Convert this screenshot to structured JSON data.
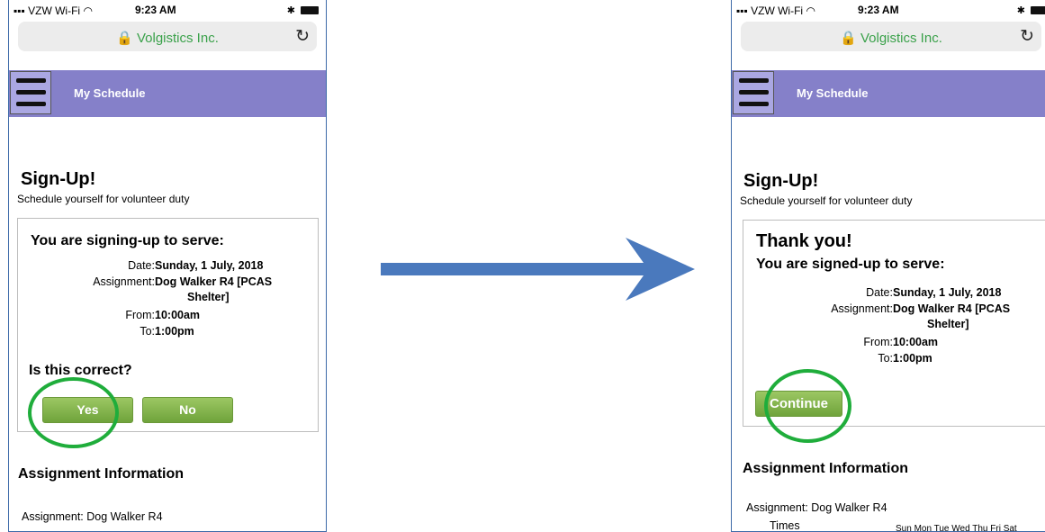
{
  "status_bar": {
    "carrier": "VZW Wi-Fi",
    "time": "9:23 AM"
  },
  "browser": {
    "site": "Volgistics Inc."
  },
  "nav": {
    "title": "My Schedule"
  },
  "page": {
    "title": "Sign-Up!",
    "subtitle": "Schedule yourself for volunteer duty"
  },
  "left": {
    "heading": "You are signing-up to serve:",
    "date_label": "Date:",
    "date_value": "Sunday, 1 July, 2018",
    "assignment_label": "Assignment:",
    "assignment_value_1": "Dog Walker R4 [PCAS",
    "assignment_value_2": "Shelter]",
    "from_label": "From:",
    "from_value": "10:00am",
    "to_label": "To:",
    "to_value": "1:00pm",
    "question": "Is this correct?",
    "yes_label": "Yes",
    "no_label": "No",
    "section_title": "Assignment Information",
    "assignment_info": "Assignment: Dog Walker R4"
  },
  "right": {
    "thanks": "Thank you!",
    "heading": "You are signed-up to serve:",
    "date_label": "Date:",
    "date_value": "Sunday, 1 July, 2018",
    "assignment_label": "Assignment:",
    "assignment_value_1": "Dog Walker R4 [PCAS",
    "assignment_value_2": "Shelter]",
    "from_label": "From:",
    "from_value": "10:00am",
    "to_label": "To:",
    "to_value": "1:00pm",
    "continue_label": "Continue",
    "section_title": "Assignment Information",
    "assignment_info": "Assignment: Dog Walker R4",
    "times_label": "Times",
    "days": "Sun Mon Tue Wed Thu Fri Sat"
  },
  "colors": {
    "nav": "#8580c9",
    "button": "#7fb04a",
    "highlight_circle": "#1fad3b",
    "arrow": "#4a79bd",
    "secure_site": "#3aa14a"
  }
}
